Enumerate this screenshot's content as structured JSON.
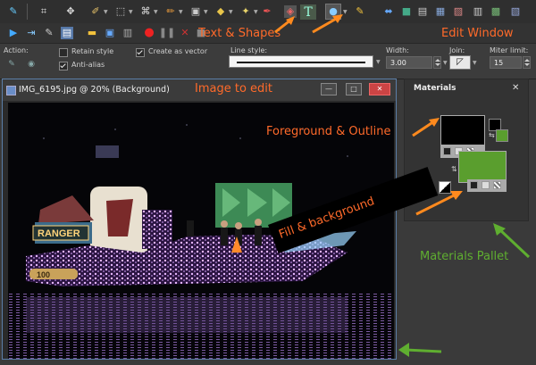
{
  "annotations": {
    "text_shapes": "Text & Shapes",
    "edit_window": "Edit Window",
    "image_to_edit": "Image to edit",
    "foreground_outline": "Foreground & Outline",
    "fill_background": "Fill & background",
    "materials_pallet": "Materials Pallet"
  },
  "tool_options": {
    "action_label": "Action:",
    "retain_style": "Retain style",
    "anti_alias": "Anti-alias",
    "create_as_vector": "Create as vector",
    "line_style_label": "Line style:",
    "width_label": "Width:",
    "width_value": "3.00",
    "join_label": "Join:",
    "miter_label": "Miter limit:",
    "miter_value": "15"
  },
  "image_window": {
    "title": "IMG_6195.jpg @  20% (Background)",
    "minimize_glyph": "—",
    "maximize_glyph": "□",
    "close_glyph": "✕"
  },
  "materials": {
    "title": "Materials",
    "close_glyph": "✕",
    "foreground_color": "#000000",
    "background_color": "#5a9e2e"
  },
  "colors": {
    "annotation": "#ff6a2a",
    "arrow_orange": "#ff8a1e",
    "arrow_green": "#5fae30",
    "fill_green": "#5a9e2e"
  }
}
